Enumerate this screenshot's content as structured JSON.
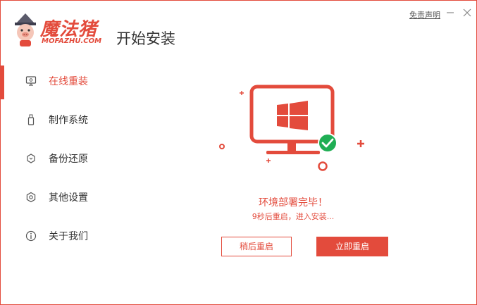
{
  "app": {
    "logo_main": "魔法猪",
    "logo_sub": "MOFAZHU.COM",
    "title": "开始安装"
  },
  "window_controls": {
    "disclaimer": "免责声明",
    "minimize_icon": "minimize-icon",
    "close_icon": "close-icon"
  },
  "sidebar": {
    "items": [
      {
        "label": "在线重装",
        "icon": "monitor-icon",
        "active": true
      },
      {
        "label": "制作系统",
        "icon": "usb-icon",
        "active": false
      },
      {
        "label": "备份还原",
        "icon": "backup-icon",
        "active": false
      },
      {
        "label": "其他设置",
        "icon": "gear-icon",
        "active": false
      },
      {
        "label": "关于我们",
        "icon": "info-icon",
        "active": false
      }
    ]
  },
  "main": {
    "status_title": "环境部署完毕！",
    "status_sub": "9秒后重启，进入安装...",
    "later_button": "稍后重启",
    "restart_button": "立即重启"
  },
  "colors": {
    "accent": "#e34b3c",
    "success": "#1fae54",
    "text": "#333333"
  }
}
